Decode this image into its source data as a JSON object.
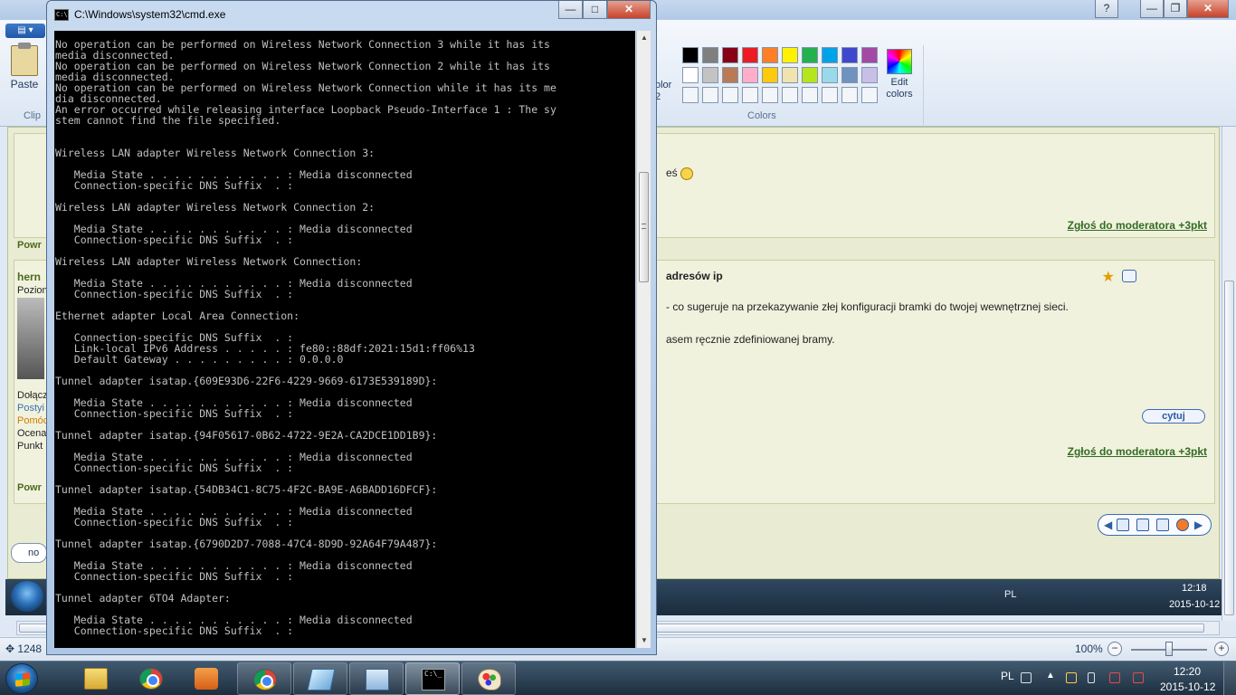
{
  "cmd": {
    "title": "C:\\Windows\\system32\\cmd.exe",
    "icon_text": "C:\\",
    "output": [
      "No operation can be performed on Wireless Network Connection 3 while it has its",
      "media disconnected.",
      "No operation can be performed on Wireless Network Connection 2 while it has its",
      "media disconnected.",
      "No operation can be performed on Wireless Network Connection while it has its me",
      "dia disconnected.",
      "An error occurred while releasing interface Loopback Pseudo-Interface 1 : The sy",
      "stem cannot find the file specified.",
      "",
      "",
      "Wireless LAN adapter Wireless Network Connection 3:",
      "",
      "   Media State . . . . . . . . . . . : Media disconnected",
      "   Connection-specific DNS Suffix  . :",
      "",
      "Wireless LAN adapter Wireless Network Connection 2:",
      "",
      "   Media State . . . . . . . . . . . : Media disconnected",
      "   Connection-specific DNS Suffix  . :",
      "",
      "Wireless LAN adapter Wireless Network Connection:",
      "",
      "   Media State . . . . . . . . . . . : Media disconnected",
      "   Connection-specific DNS Suffix  . :",
      "",
      "Ethernet adapter Local Area Connection:",
      "",
      "   Connection-specific DNS Suffix  . :",
      "   Link-local IPv6 Address . . . . . : fe80::88df:2021:15d1:ff06%13",
      "   Default Gateway . . . . . . . . . : 0.0.0.0",
      "",
      "Tunnel adapter isatap.{609E93D6-22F6-4229-9669-6173E539189D}:",
      "",
      "   Media State . . . . . . . . . . . : Media disconnected",
      "   Connection-specific DNS Suffix  . :",
      "",
      "Tunnel adapter isatap.{94F05617-0B62-4722-9E2A-CA2DCE1DD1B9}:",
      "",
      "   Media State . . . . . . . . . . . : Media disconnected",
      "   Connection-specific DNS Suffix  . :",
      "",
      "Tunnel adapter isatap.{54DB34C1-8C75-4F2C-BA9E-A6BADD16DFCF}:",
      "",
      "   Media State . . . . . . . . . . . : Media disconnected",
      "   Connection-specific DNS Suffix  . :",
      "",
      "Tunnel adapter isatap.{6790D2D7-7088-47C4-8D9D-92A64F79A487}:",
      "",
      "   Media State . . . . . . . . . . . : Media disconnected",
      "   Connection-specific DNS Suffix  . :",
      "",
      "Tunnel adapter 6TO4 Adapter:",
      "",
      "   Media State . . . . . . . . . . . : Media disconnected",
      "   Connection-specific DNS Suffix  . :"
    ],
    "scroll_grip": "≡",
    "scroll_up": "▲",
    "scroll_down": "▼",
    "min_glyph": "—",
    "max_glyph": "□",
    "close_glyph": "✕"
  },
  "paint": {
    "file_menu_glyph": "▤ ▾",
    "paste_label": "Paste",
    "clipboard_group_label": "Clip",
    "color2_label": "olor\n2",
    "colors_group_label": "Colors",
    "edit_colors_label": "Edit\ncolors",
    "palette": [
      "#000000",
      "#7f7f7f",
      "#880015",
      "#ed1c24",
      "#ff7f27",
      "#fff200",
      "#22b14c",
      "#00a2e8",
      "#3f48cc",
      "#a349a4",
      "#ffffff",
      "#c3c3c3",
      "#b97a57",
      "#ffaec9",
      "#ffc90e",
      "#efe4b0",
      "#b5e61d",
      "#99d9ea",
      "#7092be",
      "#c8bfe7",
      "#f2f5f9",
      "#f2f5f9",
      "#f2f5f9",
      "#f2f5f9",
      "#f2f5f9",
      "#f2f5f9",
      "#f2f5f9",
      "#f2f5f9",
      "#f2f5f9",
      "#f2f5f9"
    ],
    "status_position": "1248",
    "status_move_glyph": "✥",
    "zoom_level": "100%",
    "zoom_out": "−",
    "zoom_in": "+",
    "win_min": "—",
    "win_max": "❐",
    "win_close": "✕",
    "win_help": "?"
  },
  "forum": {
    "text_snippet_1": "eś",
    "report_1": "Zgłoś do moderatora +3pkt",
    "report_2": "Zgłoś do moderatora +3pkt",
    "post_title_fragment": "adresów ip",
    "quote_button": "cytuj",
    "post_line_1": "- co sugeruje na przekazywanie złej konfiguracji bramki do twojej wewnętrznej sieci.",
    "post_line_2": "asem ręcznie zdefiniowanej bramy.",
    "powr_1": "Powr",
    "powr_2": "Powr",
    "user_fragment": "hern",
    "side_labels": [
      "Pozion",
      "Dołącz",
      "Postyi",
      "Pomóc",
      "Ocena",
      "Punkt"
    ],
    "status_button": "no",
    "inner_taskbar_lang": "PL",
    "inner_clock_time": "12:18",
    "inner_clock_date": "2015-10-12"
  },
  "taskbar": {
    "lang": "PL",
    "clock_time": "12:20",
    "clock_date": "2015-10-12",
    "cmd_icon_text": "C:\\_"
  }
}
